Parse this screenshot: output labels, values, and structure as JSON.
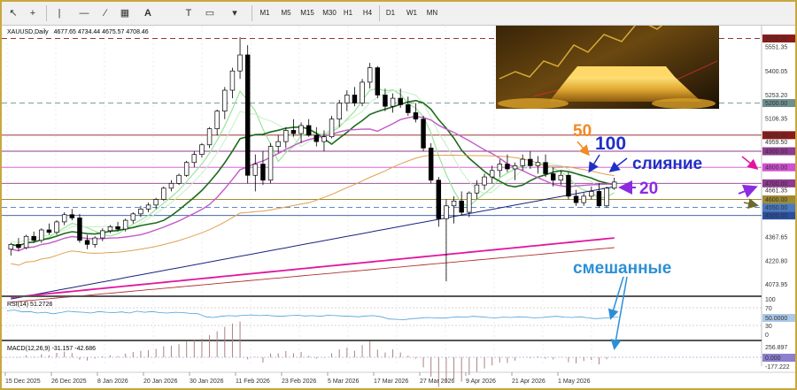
{
  "toolbar": {
    "icons": [
      "pointer-icon",
      "crosshair-icon",
      "vertical-line-icon",
      "horizontal-line-icon",
      "trendline-icon",
      "channel-icon",
      "text-icon",
      "label-icon",
      "shapes-icon",
      "more-tools-icon"
    ],
    "timeframes": [
      "M1",
      "M5",
      "M15",
      "M30",
      "H1",
      "H4",
      "D1",
      "W1",
      "MN"
    ],
    "active_timeframe": "D1"
  },
  "header": {
    "symbol": "XAUUSD,Daily",
    "ohlc": "4677.65 4734.44 4675.57 4708.46"
  },
  "colors": {
    "bull": "#000000",
    "bear": "#000000",
    "ma20": "#1b6b1b",
    "ma20_light": "#9be39b",
    "ma50": "#e0a050",
    "ma100": "#1a237e",
    "ma_purple": "#c35ac9",
    "ma_magenta": "#e0169e",
    "ma_darkred": "#b03030",
    "rsi": "#4a9fd8",
    "macd": "#8b2b2b",
    "annotation_orange": "#f08a24",
    "annotation_blue": "#1f2fc8",
    "annotation_purple": "#8b2be2",
    "annotation_cyan": "#2c8fd6"
  },
  "price_axis": {
    "labels": [
      "5551.35",
      "5400.05",
      "5253.20",
      "5106.35",
      "4959.50",
      "4661.35",
      "4367.65",
      "4220.80",
      "4073.95"
    ],
    "min": 4030,
    "max": 5660
  },
  "levels": [
    {
      "price": 5602,
      "label": "5602.00",
      "color": "#8b1a1a",
      "style": "dashed"
    },
    {
      "price": 5200,
      "label": "5200.00",
      "color": "#6f8f8f",
      "style": "dashed"
    },
    {
      "price": 5000,
      "label": "5000.00",
      "color": "#8b1a1a",
      "style": "solid"
    },
    {
      "price": 4900,
      "label": "4900.00",
      "color": "#8e3a8e",
      "style": "solid"
    },
    {
      "price": 4800,
      "label": "4800.00",
      "color": "#d14fd1",
      "style": "solid"
    },
    {
      "price": 4700,
      "label": "4700.00",
      "color": "#8e3a8e",
      "style": "solid"
    },
    {
      "price": 4600,
      "label": "4600.00",
      "color": "#a08a30",
      "style": "solid"
    },
    {
      "price": 4550,
      "label": "4550.00",
      "color": "#4a7ac0",
      "style": "dashed"
    },
    {
      "price": 4500,
      "label": "4500.00",
      "color": "#2a4fa0",
      "style": "solid"
    }
  ],
  "x_axis": {
    "labels": [
      "15 Dec 2025",
      "26 Dec 2025",
      "8 Jan 2026",
      "20 Jan 2026",
      "30 Jan 2026",
      "11 Feb 2026",
      "23 Feb 2026",
      "5 Mar 2026",
      "17 Mar 2026",
      "27 Mar 2026",
      "9 Apr 2026",
      "21 Apr 2026",
      "1 May 2026"
    ]
  },
  "rsi": {
    "label": "RSI(14) 51.2726",
    "axis": [
      "100",
      "70",
      "50.0000",
      "30",
      "0"
    ],
    "values": [
      68,
      70,
      65,
      66,
      62,
      64,
      60,
      63,
      67,
      65,
      64,
      62,
      66,
      64,
      63,
      65,
      62,
      67,
      64,
      66,
      63,
      62,
      64,
      63,
      61,
      60,
      52,
      50,
      53,
      55,
      54,
      56,
      57,
      55,
      56,
      54,
      53,
      55,
      56,
      54,
      55,
      53,
      56,
      55,
      54,
      53,
      52,
      54,
      55,
      52,
      46,
      45,
      44,
      47,
      48,
      50,
      49,
      48,
      50,
      52,
      51,
      53,
      52,
      50,
      49,
      51,
      50,
      52,
      51,
      49,
      50,
      52,
      53,
      51,
      50,
      52,
      49,
      47,
      48,
      50,
      51
    ]
  },
  "macd": {
    "label": "MACD(12,26,9) -31.157 -42.686",
    "axis": [
      "256.897",
      "0.000",
      "-177.222"
    ]
  },
  "annotations": {
    "ma50_label": "50",
    "ma100_label": "100",
    "merge_label": "слияние",
    "ma20_label": "20",
    "mixed_label": "смешанные"
  },
  "chart_data": {
    "type": "candlestick",
    "symbol": "XAUUSD,Daily",
    "candles": [
      [
        4290,
        4330,
        4250,
        4320
      ],
      [
        4320,
        4360,
        4280,
        4300
      ],
      [
        4300,
        4380,
        4290,
        4370
      ],
      [
        4370,
        4400,
        4330,
        4345
      ],
      [
        4345,
        4420,
        4330,
        4410
      ],
      [
        4410,
        4450,
        4380,
        4395
      ],
      [
        4395,
        4470,
        4380,
        4460
      ],
      [
        4460,
        4520,
        4440,
        4505
      ],
      [
        4505,
        4540,
        4470,
        4485
      ],
      [
        4485,
        4510,
        4330,
        4345
      ],
      [
        4345,
        4380,
        4290,
        4320
      ],
      [
        4320,
        4370,
        4300,
        4360
      ],
      [
        4360,
        4420,
        4340,
        4405
      ],
      [
        4405,
        4440,
        4390,
        4430
      ],
      [
        4430,
        4460,
        4400,
        4415
      ],
      [
        4415,
        4480,
        4400,
        4470
      ],
      [
        4470,
        4520,
        4450,
        4510
      ],
      [
        4510,
        4560,
        4490,
        4540
      ],
      [
        4540,
        4580,
        4520,
        4565
      ],
      [
        4565,
        4610,
        4540,
        4600
      ],
      [
        4600,
        4680,
        4590,
        4670
      ],
      [
        4670,
        4720,
        4650,
        4700
      ],
      [
        4700,
        4760,
        4690,
        4750
      ],
      [
        4750,
        4840,
        4740,
        4830
      ],
      [
        4830,
        4900,
        4800,
        4880
      ],
      [
        4880,
        4950,
        4860,
        4940
      ],
      [
        4940,
        5050,
        4920,
        5040
      ],
      [
        5040,
        5160,
        5000,
        5150
      ],
      [
        5150,
        5300,
        5100,
        5280
      ],
      [
        5280,
        5420,
        5230,
        5400
      ],
      [
        5400,
        5610,
        5350,
        5500
      ],
      [
        5500,
        5560,
        4700,
        4750
      ],
      [
        4750,
        4880,
        4650,
        4820
      ],
      [
        4820,
        4900,
        4690,
        4720
      ],
      [
        4720,
        4950,
        4700,
        4930
      ],
      [
        4930,
        5000,
        4890,
        4960
      ],
      [
        4960,
        5050,
        4920,
        5030
      ],
      [
        5030,
        5100,
        4990,
        5010
      ],
      [
        5010,
        5080,
        4950,
        5060
      ],
      [
        5060,
        5100,
        4990,
        5000
      ],
      [
        5000,
        5050,
        4930,
        4960
      ],
      [
        4960,
        5030,
        4900,
        4990
      ],
      [
        4990,
        5120,
        4980,
        5100
      ],
      [
        5100,
        5220,
        5050,
        5200
      ],
      [
        5200,
        5280,
        5150,
        5250
      ],
      [
        5250,
        5300,
        5180,
        5200
      ],
      [
        5200,
        5350,
        5180,
        5330
      ],
      [
        5330,
        5450,
        5290,
        5420
      ],
      [
        5420,
        5430,
        5230,
        5250
      ],
      [
        5250,
        5290,
        5150,
        5180
      ],
      [
        5180,
        5260,
        5140,
        5230
      ],
      [
        5230,
        5290,
        5170,
        5190
      ],
      [
        5190,
        5240,
        5120,
        5140
      ],
      [
        5140,
        5200,
        5080,
        5100
      ],
      [
        5100,
        5120,
        4900,
        4920
      ],
      [
        4920,
        4950,
        4700,
        4720
      ],
      [
        4720,
        4740,
        4430,
        4480
      ],
      [
        4480,
        4600,
        4090,
        4560
      ],
      [
        4560,
        4620,
        4450,
        4590
      ],
      [
        4590,
        4650,
        4500,
        4520
      ],
      [
        4520,
        4650,
        4490,
        4640
      ],
      [
        4640,
        4720,
        4600,
        4690
      ],
      [
        4690,
        4760,
        4660,
        4740
      ],
      [
        4740,
        4810,
        4700,
        4780
      ],
      [
        4780,
        4850,
        4740,
        4820
      ],
      [
        4820,
        4880,
        4770,
        4790
      ],
      [
        4790,
        4830,
        4720,
        4810
      ],
      [
        4810,
        4880,
        4780,
        4850
      ],
      [
        4850,
        4900,
        4790,
        4810
      ],
      [
        4810,
        4870,
        4760,
        4830
      ],
      [
        4830,
        4880,
        4740,
        4760
      ],
      [
        4760,
        4800,
        4680,
        4720
      ],
      [
        4720,
        4780,
        4690,
        4750
      ],
      [
        4750,
        4770,
        4600,
        4620
      ],
      [
        4620,
        4660,
        4560,
        4580
      ],
      [
        4580,
        4640,
        4560,
        4620
      ],
      [
        4620,
        4680,
        4600,
        4650
      ],
      [
        4650,
        4700,
        4550,
        4560
      ],
      [
        4560,
        4680,
        4550,
        4670
      ],
      [
        4670,
        4735,
        4660,
        4708
      ]
    ],
    "moving_averages": [
      {
        "name": "20",
        "color": "#1b6b1b"
      },
      {
        "name": "50",
        "color": "#e0a050"
      },
      {
        "name": "100",
        "color": "#1a237e"
      }
    ]
  }
}
